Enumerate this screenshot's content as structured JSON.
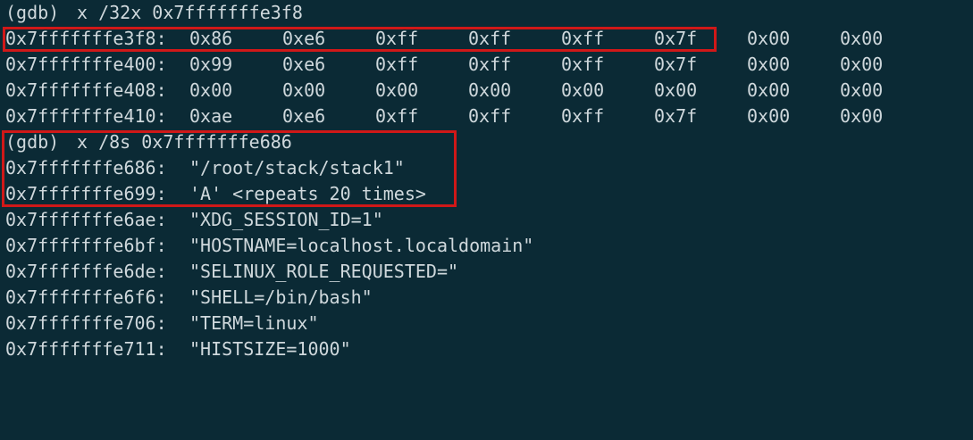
{
  "prompt": "(gdb)",
  "hex_block": {
    "command": "x /32x 0x7fffffffe3f8",
    "rows": [
      {
        "address": "0x7fffffffe3f8:",
        "bytes": [
          "0x86",
          "0xe6",
          "0xff",
          "0xff",
          "0xff",
          "0x7f",
          "0x00",
          "0x00"
        ]
      },
      {
        "address": "0x7fffffffe400:",
        "bytes": [
          "0x99",
          "0xe6",
          "0xff",
          "0xff",
          "0xff",
          "0x7f",
          "0x00",
          "0x00"
        ]
      },
      {
        "address": "0x7fffffffe408:",
        "bytes": [
          "0x00",
          "0x00",
          "0x00",
          "0x00",
          "0x00",
          "0x00",
          "0x00",
          "0x00"
        ]
      },
      {
        "address": "0x7fffffffe410:",
        "bytes": [
          "0xae",
          "0xe6",
          "0xff",
          "0xff",
          "0xff",
          "0x7f",
          "0x00",
          "0x00"
        ]
      }
    ]
  },
  "string_block": {
    "command": "x /8s 0x7fffffffe686",
    "rows": [
      {
        "address": "0x7fffffffe686:",
        "value": "\"/root/stack/stack1\""
      },
      {
        "address": "0x7fffffffe699:",
        "value": "'A' <repeats 20 times>"
      },
      {
        "address": "0x7fffffffe6ae:",
        "value": "\"XDG_SESSION_ID=1\""
      },
      {
        "address": "0x7fffffffe6bf:",
        "value": "\"HOSTNAME=localhost.localdomain\""
      },
      {
        "address": "0x7fffffffe6de:",
        "value": "\"SELINUX_ROLE_REQUESTED=\""
      },
      {
        "address": "0x7fffffffe6f6:",
        "value": "\"SHELL=/bin/bash\""
      },
      {
        "address": "0x7fffffffe706:",
        "value": "\"TERM=linux\""
      },
      {
        "address": "0x7fffffffe711:",
        "value": "\"HISTSIZE=1000\""
      }
    ]
  },
  "colors": {
    "background": "#0b2a35",
    "text": "#cfd8dc",
    "highlight_box": "#d01818"
  }
}
